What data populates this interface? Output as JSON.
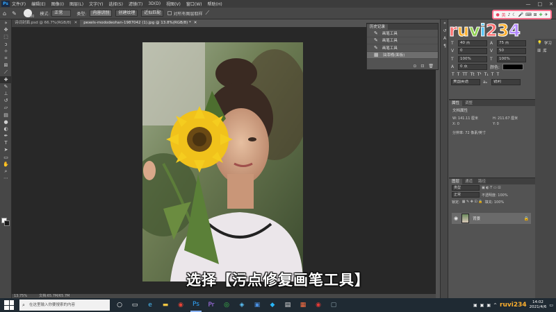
{
  "menubar": {
    "app_badge": "Ps",
    "items": [
      "文件(F)",
      "编辑(E)",
      "图像(I)",
      "图层(L)",
      "文字(Y)",
      "选择(S)",
      "滤镜(T)",
      "3D(D)",
      "视图(V)",
      "窗口(W)",
      "帮助(H)"
    ],
    "controls": [
      "—",
      "□",
      "✕"
    ]
  },
  "options": {
    "brush_size": "200",
    "mode_label": "模式:",
    "mode_value": "正常",
    "type_label": "类型:",
    "btn_content_aware": "内容识别",
    "btn_create_texture": "创建纹理",
    "btn_proximity": "近似匹配",
    "sample_all_label": "对所有图层取样"
  },
  "tabs": [
    {
      "label": "诗词封面.psd @ 66.7%(RGB/8)",
      "close": "✕"
    },
    {
      "label": "pexels-mododeohan-1987042 (1).jpg @ 13.8%(RGB/8) *",
      "close": "✕"
    }
  ],
  "watermark": {
    "logo_text": "ruvi234",
    "toolbar_icons": [
      "●",
      "英",
      "♪",
      "☾",
      "🎤",
      "⌨",
      "⊞",
      "✚",
      "✈"
    ]
  },
  "history": {
    "tab_active": "历史记录",
    "items": [
      "画笔工具",
      "画笔工具",
      "画笔工具",
      "油漆桶(面板)"
    ],
    "footer_icons": [
      "⊙",
      "⊡",
      "🗑"
    ]
  },
  "character": {
    "font_size": "40 点",
    "leading": "75 点",
    "kerning": "0",
    "tracking": "50",
    "vscale": "100%",
    "hscale": "100%",
    "baseline": "0 点",
    "color_label": "颜色:",
    "language": "美国英语",
    "aa": "锐利",
    "aa_short": "aₐ"
  },
  "properties": {
    "tab_active": "属性",
    "tab2": "调整",
    "doc_label": "文档属性",
    "w": "W: 141.11 厘米",
    "h": "H: 211.67 厘米",
    "x": "X: 0",
    "y": "Y: 0",
    "resolution": "分辨率: 72 像素/英寸"
  },
  "layers": {
    "tabs": [
      "图层",
      "通道",
      "路径"
    ],
    "kind": "类型",
    "blend": "正常",
    "opacity": "不透明度: 100%",
    "lock": "锁定:",
    "fill": "填充: 100%",
    "layer_name": "背景"
  },
  "right_panel": {
    "learn": "学习",
    "library": "库"
  },
  "status": {
    "zoom": "13.75%",
    "doc": "文档:65.7M/65.7M"
  },
  "subtitle": "选择【污点修复画笔工具】",
  "taskbar": {
    "search_placeholder": "在这里输入你要搜索的内容",
    "clock_time": "14:02",
    "clock_date": "2021/4/6",
    "tray_logo": "ruvi234"
  }
}
